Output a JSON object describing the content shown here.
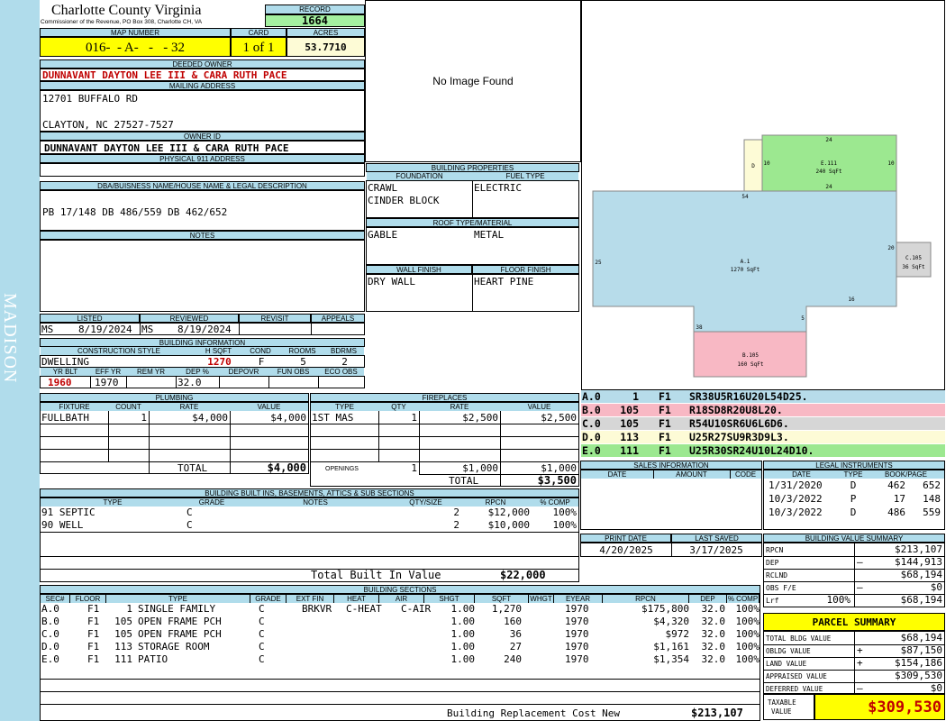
{
  "sidebar": {
    "label": "MADISON"
  },
  "header": {
    "county": "Charlotte County Virginia",
    "commissioner": "Commissioner of the Revenue, PO Box 308, Charlotte CH, VA",
    "record_label": "RECORD",
    "record": "1664",
    "map_number_label": "MAP NUMBER",
    "map_number": "016-  - A-   -   - 32",
    "card_label": "CARD",
    "card": "1 of 1",
    "acres_label": "ACRES",
    "acres": "53.7710"
  },
  "owner": {
    "deeded_owner_label": "DEEDED OWNER",
    "deeded_owner": "DUNNAVANT DAYTON LEE III & CARA RUTH PACE",
    "mailing_label": "MAILING ADDRESS",
    "mailing_line1": "12701 BUFFALO RD",
    "mailing_line2": "CLAYTON, NC 27527-7527",
    "owner_id_label": "OWNER ID",
    "owner_id": "DUNNAVANT DAYTON LEE III & CARA RUTH PACE",
    "physical_label": "PHYSICAL 911 ADDRESS",
    "dba_label": "DBA/BUISNESS NAME/HOUSE NAME & LEGAL DESCRIPTION",
    "legal": "PB 17/148 DB 486/559 DB 462/652",
    "notes_label": "NOTES"
  },
  "listing": {
    "listed_label": "LISTED",
    "reviewed_label": "REVIEWED",
    "revisit_label": "REVISIT",
    "appeals_label": "APPEALS",
    "listed_by": "MS",
    "listed_date": "8/19/2024",
    "reviewed_by": "MS",
    "reviewed_date": "8/19/2024"
  },
  "building_info": {
    "title": "BUILDING INFORMATION",
    "construction_label": "CONSTRUCTION STYLE",
    "hsqft_label": "H SQFT",
    "cond_label": "COND",
    "rooms_label": "ROOMS",
    "bdrms_label": "BDRMS",
    "construction": "DWELLING",
    "hsqft": "1270",
    "cond": "F",
    "rooms": "5",
    "bdrms": "2",
    "yrblt_label": "YR BLT",
    "effyr_label": "EFF YR",
    "remyr_label": "REM YR",
    "dep_label": "DEP %",
    "depovr_label": "DEPOVR",
    "funobs_label": "FUN OBS",
    "ecoobs_label": "ECO OBS",
    "yrblt": "1960",
    "effyr": "1970",
    "dep": "32.0"
  },
  "image": {
    "no_image": "No Image Found"
  },
  "properties": {
    "title": "BUILDING PROPERTIES",
    "foundation_label": "FOUNDATION",
    "fuel_label": "FUEL TYPE",
    "foundation1": "CRAWL",
    "foundation2": "CINDER BLOCK",
    "fuel": "ELECTRIC",
    "roof_label": "ROOF TYPE/MATERIAL",
    "roof_type": "GABLE",
    "roof_material": "METAL",
    "wall_label": "WALL FINISH",
    "floor_label": "FLOOR FINISH",
    "wall": "DRY WALL",
    "floor": "HEART PINE"
  },
  "sketch": {
    "areas": [
      {
        "id": "A.1",
        "sqft": "1270 SqFt",
        "color": "#b7dcea"
      },
      {
        "id": "B.105",
        "sqft": "160 SqFt",
        "color": "#f8b8c4"
      },
      {
        "id": "C.105",
        "sqft": "36 SqFt",
        "color": "#d6d6d6"
      },
      {
        "id": "D",
        "sqft": "",
        "color": "#fdfbd6"
      },
      {
        "id": "E.111",
        "sqft": "240 SqFt",
        "color": "#9ce890"
      }
    ],
    "dims": [
      "24",
      "10",
      "10",
      "24",
      "54",
      "20",
      "25",
      "16",
      "5",
      "38"
    ]
  },
  "legend": [
    {
      "code": "A.0",
      "n": "1",
      "fl": "F1",
      "vec": "SR38U5R16U20L54D25.",
      "color": "#b7dcea"
    },
    {
      "code": "B.0",
      "n": "105",
      "fl": "F1",
      "vec": "R18SD8R20U8L20.",
      "color": "#f8b8c4"
    },
    {
      "code": "C.0",
      "n": "105",
      "fl": "F1",
      "vec": "R54U10SR6U6L6D6.",
      "color": "#d6d6d6"
    },
    {
      "code": "D.0",
      "n": "113",
      "fl": "F1",
      "vec": "U25R27SU9R3D9L3.",
      "color": "#fdfbd6"
    },
    {
      "code": "E.0",
      "n": "111",
      "fl": "F1",
      "vec": "U25R30SR24U10L24D10.",
      "color": "#9ce890"
    }
  ],
  "plumbing": {
    "title": "PLUMBING",
    "fixture_label": "FIXTURE",
    "count_label": "COUNT",
    "rate_label": "RATE",
    "value_label": "VALUE",
    "fixture": "FULLBATH",
    "count": "1",
    "rate": "$4,000",
    "value": "$4,000",
    "total_label": "TOTAL",
    "total": "$4,000"
  },
  "fireplaces": {
    "title": "FIREPLACES",
    "type_label": "TYPE",
    "qty_label": "QTY",
    "rate_label": "RATE",
    "value_label": "VALUE",
    "type": "1ST MAS",
    "qty": "1",
    "rate": "$2,500",
    "value": "$2,500",
    "openings_label": "OPENINGS",
    "openings_qty": "1",
    "openings_rate": "$1,000",
    "openings_value": "$1,000",
    "total_label": "TOTAL",
    "total": "$3,500"
  },
  "sales": {
    "title": "SALES INFORMATION",
    "date_label": "DATE",
    "amount_label": "AMOUNT",
    "code_label": "CODE"
  },
  "legal_instruments": {
    "title": "LEGAL INSTRUMENTS",
    "date_label": "DATE",
    "type_label": "TYPE",
    "book_label": "BOOK/PAGE",
    "rows": [
      {
        "date": "1/31/2020",
        "type": "D",
        "book": "462",
        "page": "652"
      },
      {
        "date": "10/3/2022",
        "type": "P",
        "book": "17",
        "page": "148"
      },
      {
        "date": "10/3/2022",
        "type": "D",
        "book": "486",
        "page": "559"
      }
    ]
  },
  "builtins": {
    "title": "BUILDING BUILT INS, BASEMENTS, ATTICS & SUB SECTIONS",
    "type_label": "TYPE",
    "grade_label": "GRADE",
    "notes_label": "NOTES",
    "qty_label": "QTY/SIZE",
    "rpcn_label": "RPCN",
    "comp_label": "% COMP",
    "rows": [
      {
        "type": "91 SEPTIC",
        "grade": "C",
        "qty": "2",
        "rpcn": "$12,000",
        "comp": "100%"
      },
      {
        "type": "90 WELL",
        "grade": "C",
        "qty": "2",
        "rpcn": "$10,000",
        "comp": "100%"
      }
    ],
    "total_label": "Total Built In Value",
    "total": "$22,000"
  },
  "print": {
    "print_label": "PRINT DATE",
    "saved_label": "LAST SAVED",
    "print_date": "4/20/2025",
    "saved_date": "3/17/2025"
  },
  "value_summary": {
    "title": "BUILDING VALUE SUMMARY",
    "rpcn_label": "RPCN",
    "rpcn": "$213,107",
    "dep_label": "DEP",
    "dep_sign": "–",
    "dep": "$144,913",
    "rclnd_label": "RCLND",
    "rclnd": "$68,194",
    "obs_label": "OBS F/E",
    "obs_sign": "–",
    "obs": "$0",
    "lrf_label": "Lrf",
    "lrf_pct": "100%",
    "lrf": "$68,194"
  },
  "sections": {
    "title": "BUILDING SECTIONS",
    "headers": [
      "SEC#",
      "FLOOR",
      "TYPE",
      "GRADE",
      "EXT FIN",
      "HEAT",
      "AIR",
      "SHGT",
      "SQFT",
      "WHGT",
      "EYEAR",
      "RPCN",
      "DEP",
      "% COMP"
    ],
    "rows": [
      {
        "sec": "A.0",
        "floor": "F1",
        "code": "1",
        "type": "SINGLE FAMILY",
        "grade": "C",
        "ext": "BRKVR",
        "heat": "C-HEAT",
        "air": "C-AIR",
        "shgt": "1.00",
        "sqft": "1,270",
        "eyear": "1970",
        "rpcn": "$175,800",
        "dep": "32.0",
        "comp": "100%"
      },
      {
        "sec": "B.0",
        "floor": "F1",
        "code": "105",
        "type": "OPEN FRAME PCH",
        "grade": "C",
        "ext": "",
        "heat": "",
        "air": "",
        "shgt": "1.00",
        "sqft": "160",
        "eyear": "1970",
        "rpcn": "$4,320",
        "dep": "32.0",
        "comp": "100%"
      },
      {
        "sec": "C.0",
        "floor": "F1",
        "code": "105",
        "type": "OPEN FRAME PCH",
        "grade": "C",
        "ext": "",
        "heat": "",
        "air": "",
        "shgt": "1.00",
        "sqft": "36",
        "eyear": "1970",
        "rpcn": "$972",
        "dep": "32.0",
        "comp": "100%"
      },
      {
        "sec": "D.0",
        "floor": "F1",
        "code": "113",
        "type": "STORAGE ROOM",
        "grade": "C",
        "ext": "",
        "heat": "",
        "air": "",
        "shgt": "1.00",
        "sqft": "27",
        "eyear": "1970",
        "rpcn": "$1,161",
        "dep": "32.0",
        "comp": "100%"
      },
      {
        "sec": "E.0",
        "floor": "F1",
        "code": "111",
        "type": "PATIO",
        "grade": "C",
        "ext": "",
        "heat": "",
        "air": "",
        "shgt": "1.00",
        "sqft": "240",
        "eyear": "1970",
        "rpcn": "$1,354",
        "dep": "32.0",
        "comp": "100%"
      }
    ],
    "total_label": "Building Replacement Cost New",
    "total": "$213,107"
  },
  "parcel": {
    "title": "PARCEL SUMMARY",
    "total_bldg_label": "TOTAL BLDG VALUE",
    "total_bldg": "$68,194",
    "obldg_label": "OBLDG VALUE",
    "obldg_sign": "+",
    "obldg": "$87,150",
    "land_label": "LAND VALUE",
    "land_sign": "+",
    "land": "$154,186",
    "appraised_label": "APPRAISED VALUE",
    "appraised": "$309,530",
    "deferred_label": "DEFERRED VALUE",
    "deferred_sign": "–",
    "deferred": "$0",
    "taxable_label1": "TAXABLE",
    "taxable_label2": "VALUE",
    "taxable": "$309,530"
  },
  "colors": {
    "header_blue": "#b0dceb",
    "yellow": "#ffff00",
    "green": "#a4f0a0",
    "red": "#c00000"
  }
}
